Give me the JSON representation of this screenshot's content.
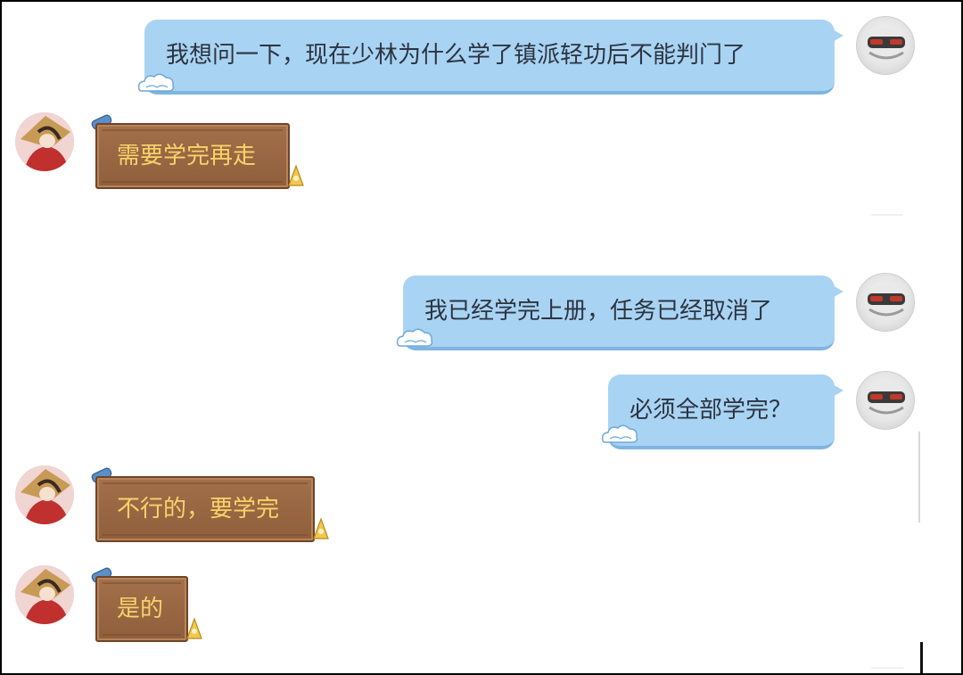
{
  "messages": [
    {
      "id": "m1",
      "from": "self",
      "text": "我想问一下，现在少林为什么学了镇派轻功后不能判门了"
    },
    {
      "id": "m2",
      "from": "other",
      "text": "需要学完再走"
    },
    {
      "id": "m3",
      "from": "self",
      "text": "我已经学完上册，任务已经取消了"
    },
    {
      "id": "m4",
      "from": "self",
      "text": "必须全部学完？"
    },
    {
      "id": "m5",
      "from": "other",
      "text": "不行的，要学完"
    },
    {
      "id": "m6",
      "from": "other",
      "text": "是的"
    }
  ],
  "colors": {
    "self_bubble": "#a9d3f3",
    "other_bubble": "#9b6843",
    "other_text": "#f8d36a",
    "self_text": "#2c3440"
  },
  "icons": {
    "self_avatar": "masked-character-avatar",
    "other_avatar": "red-robed-character-avatar",
    "cloud": "cloud-decoration-icon",
    "scroll": "scroll-decoration-icon",
    "gold": "gold-corner-decoration-icon"
  }
}
